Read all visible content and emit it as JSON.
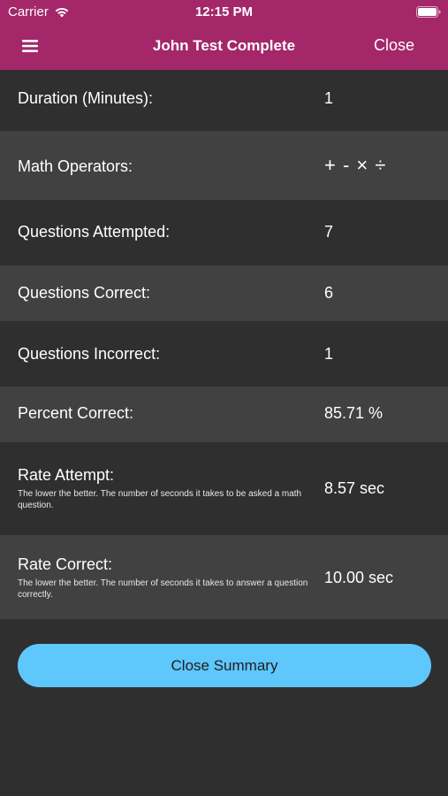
{
  "status_bar": {
    "carrier": "Carrier",
    "time": "12:15 PM"
  },
  "nav": {
    "title": "John Test Complete",
    "close_label": "Close",
    "menu_icon": "hamburger-menu-icon"
  },
  "rows": [
    {
      "label": "Duration (Minutes):",
      "value": "1"
    },
    {
      "label": "Math Operators:",
      "value": "+ - × ÷"
    },
    {
      "label": "Questions Attempted:",
      "value": "7"
    },
    {
      "label": "Questions Correct:",
      "value": "6"
    },
    {
      "label": "Questions Incorrect:",
      "value": "1"
    },
    {
      "label": "Percent Correct:",
      "value": "85.71 %"
    },
    {
      "label": "Rate Attempt:",
      "description": "The lower the better. The number of seconds it takes to be asked a math question.",
      "value": "8.57 sec"
    },
    {
      "label": "Rate Correct:",
      "description": "The lower the better. The number of seconds it takes to answer a question correctly.",
      "value": "10.00 sec"
    }
  ],
  "footer": {
    "button_label": "Close Summary"
  },
  "colors": {
    "header": "#a4276a",
    "background": "#2f2f2f",
    "row_alt": "#414141",
    "button": "#5ec7fb"
  }
}
